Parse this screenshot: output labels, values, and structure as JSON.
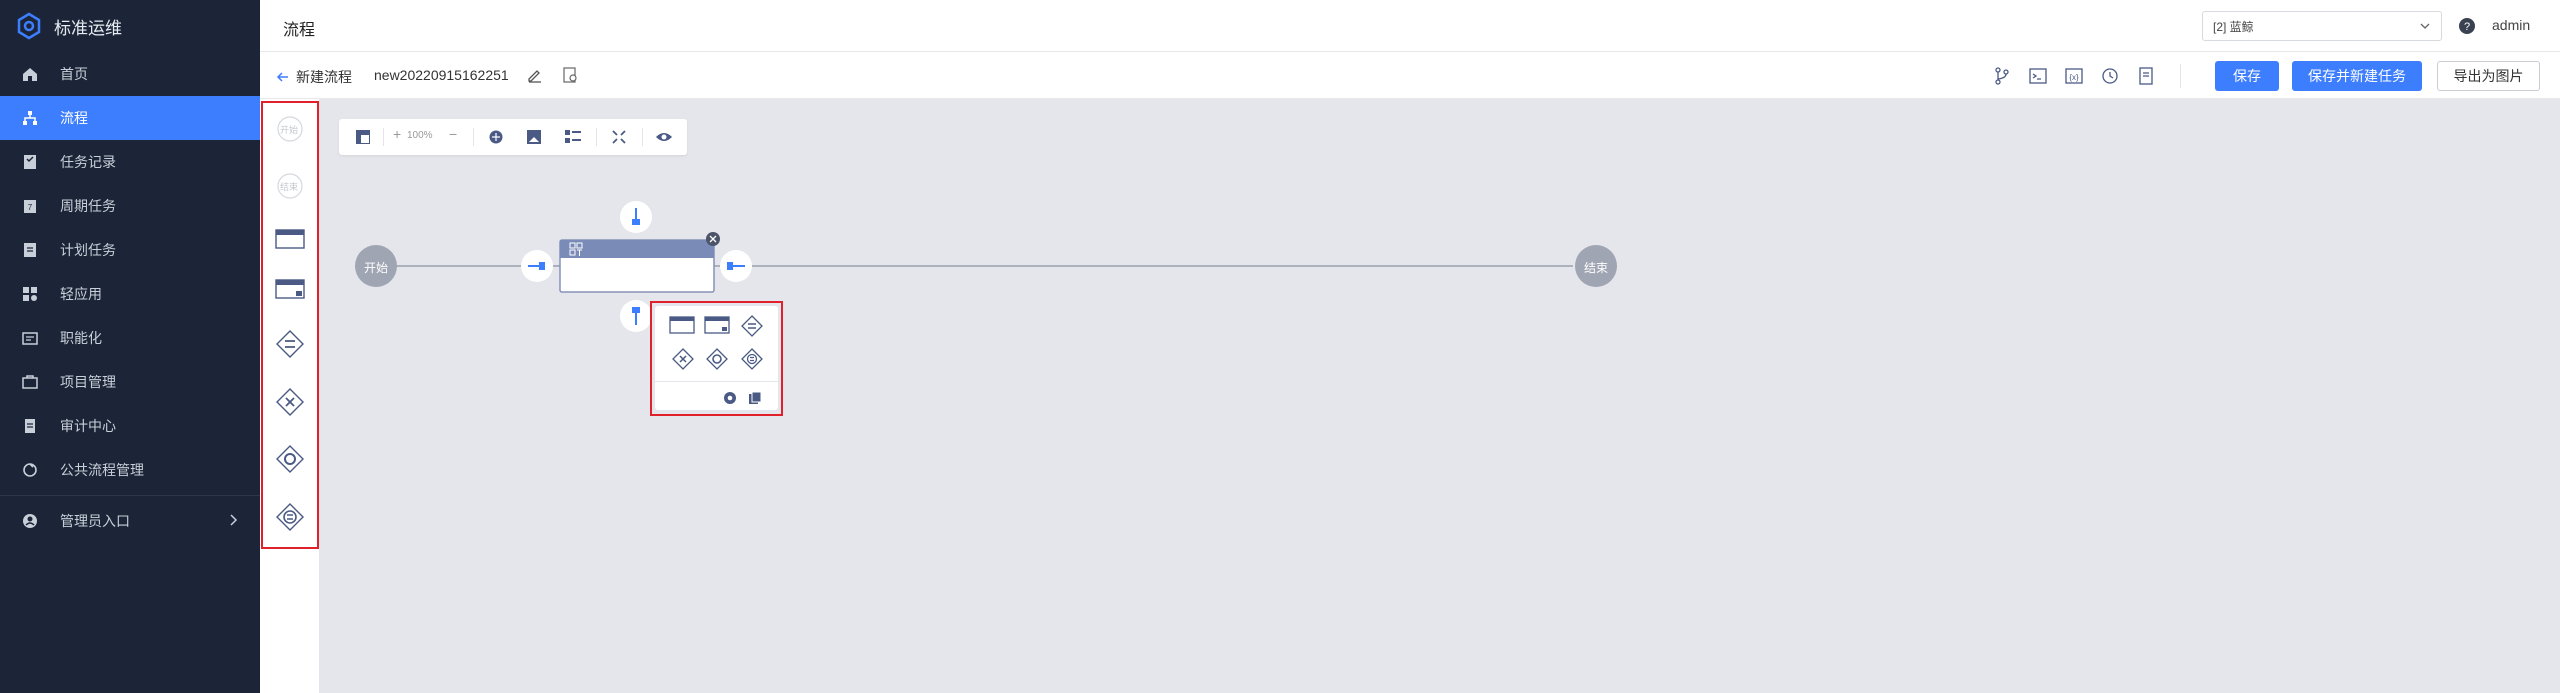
{
  "app": {
    "title": "标准运维"
  },
  "sidebar": {
    "items": [
      {
        "label": "首页",
        "icon": "home-icon"
      },
      {
        "label": "流程",
        "icon": "flow-icon",
        "active": true
      },
      {
        "label": "任务记录",
        "icon": "task-record-icon"
      },
      {
        "label": "周期任务",
        "icon": "periodic-task-icon"
      },
      {
        "label": "计划任务",
        "icon": "plan-task-icon"
      },
      {
        "label": "轻应用",
        "icon": "light-app-icon"
      },
      {
        "label": "职能化",
        "icon": "function-icon"
      },
      {
        "label": "项目管理",
        "icon": "project-manage-icon"
      },
      {
        "label": "审计中心",
        "icon": "audit-icon"
      },
      {
        "label": "公共流程管理",
        "icon": "public-flow-icon"
      }
    ],
    "admin": {
      "label": "管理员入口",
      "icon": "admin-icon"
    }
  },
  "header": {
    "title": "流程",
    "project_select": "[2] 蓝鲸",
    "user": "admin"
  },
  "toolbar": {
    "back_label": "新建流程",
    "flow_name": "new20220915162251",
    "save_label": "保存",
    "save_new_task_label": "保存并新建任务",
    "export_image_label": "导出为图片"
  },
  "canvas_tools": {
    "zoom": "100%"
  },
  "palette": {
    "start_label": "开始",
    "end_label": "结束"
  },
  "flow": {
    "start_label": "开始",
    "end_label": "结束"
  },
  "colors": {
    "accent": "#3d7eff",
    "sidebar_bg": "#1b2537",
    "node_header": "#7b8bb8",
    "node_circle": "#9fa5b2",
    "highlight": "#e0202a"
  }
}
